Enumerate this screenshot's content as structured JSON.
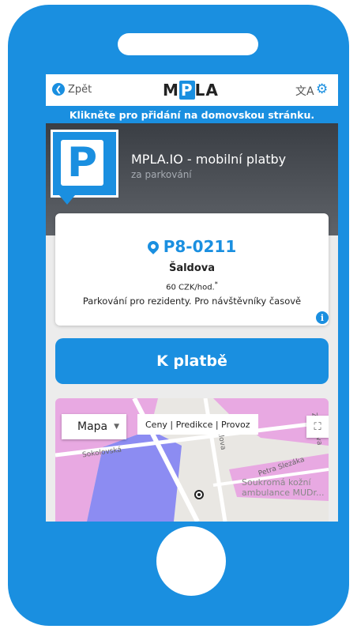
{
  "header": {
    "back_label": "Zpět",
    "logo_prefix": "M",
    "logo_p": "P",
    "logo_suffix": "LA",
    "translate_icon": "translate-icon",
    "settings_icon": "gear-icon"
  },
  "banner": {
    "text": "Klikněte pro přidání na domovskou stránku."
  },
  "hero": {
    "title": "MPLA.IO - mobilní platby",
    "subtitle": "za parkování",
    "logo_letter": "P"
  },
  "zone": {
    "code": "P8-0211",
    "street": "Šaldova",
    "price": "60 CZK/hod.",
    "price_mark": "*",
    "note": "Parkování pro rezidenty. Pro návštěvníky časově"
  },
  "pay_button": {
    "label": "K platbě"
  },
  "map": {
    "type_label": "Mapa",
    "links": "Ceny | Predikce | Provoz",
    "fullscreen_icon": "fullscreen-icon",
    "streets": [
      "Sokolovská",
      "Zenklova",
      "Petra Slezáka",
      "Zenklova"
    ],
    "poi": [
      "Soukromá kožní",
      "ambulance MUDr..."
    ]
  },
  "colors": {
    "accent": "#1a8fe0",
    "hero_dark": "#3a3e44",
    "zone_pink": "#e8a9e2",
    "zone_blue": "#8c8cf2"
  }
}
